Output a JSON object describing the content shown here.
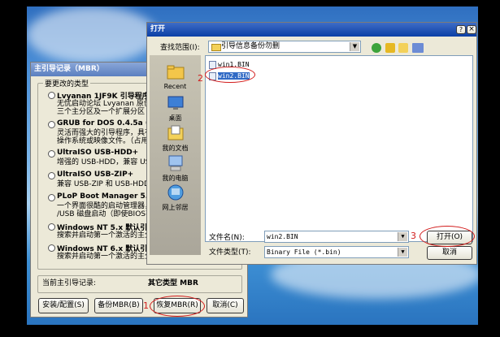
{
  "mbr_dialog": {
    "title": "主引导记录（MBR）",
    "group_label": "要更改的类型",
    "options": [
      {
        "title": "Lvyanan 1JF9K 引导程序（2",
        "desc1": "无忧启动论坛 Lvyanan 原创",
        "desc2": "三个主分区及一个扩展分区"
      },
      {
        "title": "GRUB for DOS 0.4.5a (2010-",
        "desc1": "灵活而强大的引导程序，具有",
        "desc2": "操作系统或映像文件。（占用"
      },
      {
        "title": "UltraISO USB-HDD+",
        "desc1": "增强的 USB-HDD，兼容 USB-"
      },
      {
        "title": "UltraISO USB-ZIP+",
        "desc1": "兼容 USB-ZIP 和 USB-HDD 方"
      },
      {
        "title": "PLoP Boot Manager 5.0.8 (2",
        "desc1": "一个界面很酷的启动管理器，",
        "desc2": "/USB 磁盘启动（即使BIOS不支"
      },
      {
        "title": "Windows NT 5.x 默认引导程",
        "desc1": "搜索并启动第一个激活的主分"
      },
      {
        "title": "Windows NT 6.x 默认引导程",
        "desc1": "搜索并启动第一个激活的主分"
      }
    ],
    "current_label": "当前主引导记录:",
    "current_value": "其它类型 MBR",
    "buttons": {
      "install": "安装/配置(S)",
      "backup": "备份MBR(B)",
      "restore": "恢复MBR(R)",
      "cancel": "取消(C)"
    }
  },
  "open_dialog": {
    "title": "打开",
    "title_buttons": {
      "help": "?",
      "close": "×"
    },
    "lookin_label": "查找范围(I):",
    "lookin_value": "引导信息备份勿删",
    "places": [
      {
        "label": "Recent",
        "icon": "recent-folder-icon"
      },
      {
        "label": "桌面",
        "icon": "desktop-icon"
      },
      {
        "label": "我的文档",
        "icon": "my-documents-icon"
      },
      {
        "label": "我的电脑",
        "icon": "my-computer-icon"
      },
      {
        "label": "网上邻居",
        "icon": "network-icon"
      }
    ],
    "files": [
      {
        "name": "win1.BIN",
        "selected": false
      },
      {
        "name": "win2.BIN",
        "selected": true
      }
    ],
    "filename_label": "文件名(N):",
    "filename_value": "win2.BIN",
    "filetype_label": "文件类型(T):",
    "filetype_value": "Binary File (*.bin)",
    "open_button": "打开(O)",
    "cancel_button": "取消"
  },
  "annotations": {
    "step1": "1",
    "step2": "2",
    "step3": "3"
  },
  "colors": {
    "accent": "#0a3fa6",
    "selection": "#316ac5",
    "annotation": "#d21b1b"
  }
}
